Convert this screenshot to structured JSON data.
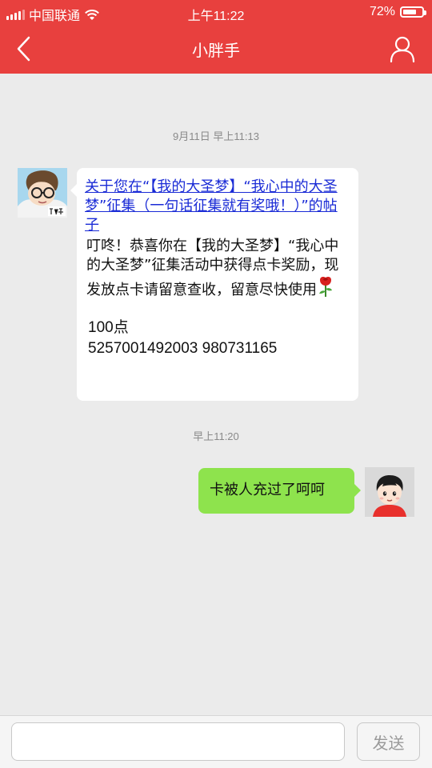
{
  "status_bar": {
    "carrier": "中国联通",
    "time": "上午11:22",
    "battery": "72%",
    "battery_level": 0.72,
    "icons": [
      "signal-icon",
      "wifi-icon",
      "battery-icon"
    ]
  },
  "nav": {
    "title": "小胖手",
    "back_icon": "chevron-left-icon",
    "profile_icon": "person-icon"
  },
  "conversation": {
    "timestamp_1": "9月11日 早上11:13",
    "incoming": {
      "link_text": "关于您在“【我的大圣梦】“我心中的大圣梦”征集（一句话征集就有奖哦！）”的帖子",
      "body": "叮咚！恭喜你在【我的大圣梦】“我心中的大圣梦”征集活动中获得点卡奖励，现发放点卡请留意查收，留意尽快使用",
      "emoji": "rose-icon",
      "points": "100点",
      "card_codes": "5257001492003 980731165"
    },
    "timestamp_2": "早上11:20",
    "outgoing": {
      "text": "卡被人充过了呵呵"
    }
  },
  "input_bar": {
    "placeholder": "",
    "send_label": "发送"
  },
  "colors": {
    "header_red": "#e8403e",
    "chat_background": "#ebebeb",
    "outgoing_bubble": "#8ee34d",
    "link_blue": "#1a2bd6"
  }
}
